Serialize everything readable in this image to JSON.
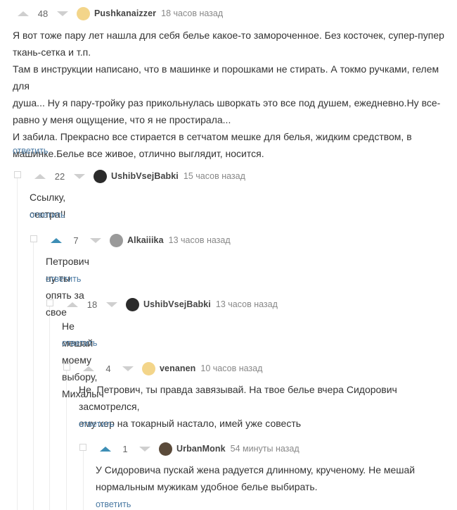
{
  "comments": [
    {
      "rating": "48",
      "vote": "none",
      "username": "Pushkanaizzer",
      "time": "18 часов назад",
      "lines": [
        "Я вот тоже пару лет нашла для себя белье какое-то замороченное. Без косточек, супер-пупер",
        "ткань-сетка и т.п.",
        "Там в инструкции написано, что в машинке и порошками не стирать. А токмо ручками, гелем для",
        "душа... Ну я пару-тройку раз прикольнулась шворкать это все под душем, ежедневно.Ну все-",
        "равно у меня ощущение, что я не простирала...",
        "И забила. Прекрасно все стирается в сетчатом мешке для белья, жидким средством, в",
        "машинке.Белье все живое, отлично выглядит, носится."
      ],
      "reply": "ответить",
      "avatar_color": "#f3d58a"
    },
    {
      "rating": "22",
      "vote": "none",
      "username": "UshibVsejBabki",
      "time": "15 часов назад",
      "lines": [
        "Ссылку, сестра!!"
      ],
      "reply": "ответить",
      "avatar_color": "#2b2b2b"
    },
    {
      "rating": "7",
      "vote": "up",
      "username": "Alkaiiika",
      "time": "13 часов назад",
      "lines": [
        "Петрович ну ты опять за свое"
      ],
      "reply": "ответить",
      "avatar_color": "#9a9a9a"
    },
    {
      "rating": "18",
      "vote": "none",
      "username": "UshibVsejBabki",
      "time": "13 часов назад",
      "lines": [
        "Не мешай моему выбору, Михалыч"
      ],
      "reply": "ответить",
      "avatar_color": "#2b2b2b"
    },
    {
      "rating": "4",
      "vote": "none",
      "username": "venanen",
      "time": "10 часов назад",
      "lines": [
        "Не, Петрович, ты правда завязывай. На твое белье вчера Сидорович засмотрелся,",
        "ему хер на токарный настало, имей уже совесть"
      ],
      "reply": "ответить",
      "avatar_color": "#f3d58a"
    },
    {
      "rating": "1",
      "vote": "up",
      "username": "UrbanMonk",
      "time": "54 минуты назад",
      "lines": [
        "У Сидоровича пускай жена радуется длинному, крученому. Не мешай",
        "нормальным мужикам удобное белье выбирать."
      ],
      "reply": "ответить",
      "avatar_color": "#5a4a3a"
    }
  ],
  "colors": {
    "vote_active": "#3d8eb5",
    "vote_inactive": "#cfcfcf",
    "reply_link": "#4b7aa3"
  }
}
